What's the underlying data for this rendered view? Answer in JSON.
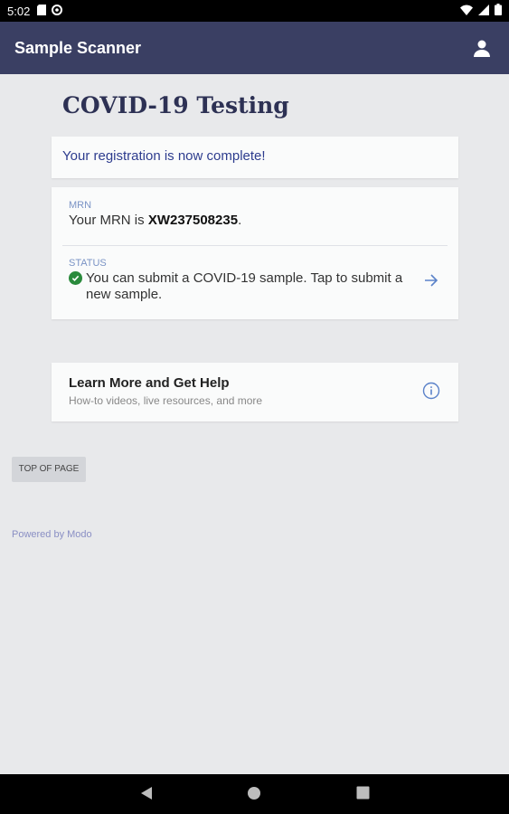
{
  "status_bar": {
    "time": "5:02"
  },
  "app_bar": {
    "title": "Sample Scanner"
  },
  "page": {
    "title": "COVID-19 Testing"
  },
  "notice": {
    "message": "Your registration is now complete!"
  },
  "mrn": {
    "label": "MRN",
    "prefix": "Your MRN is ",
    "value": "XW237508235",
    "suffix": "."
  },
  "status": {
    "label": "STATUS",
    "text": "You can submit a COVID-19 sample. Tap to submit a new sample."
  },
  "help": {
    "title": "Learn More and Get Help",
    "subtitle": "How-to videos, live resources, and more"
  },
  "top_button": {
    "label": "TOP OF PAGE"
  },
  "footer": {
    "powered": "Powered by Modo"
  },
  "colors": {
    "app_bar": "#3a3f63",
    "background": "#e8e9eb",
    "success": "#2a8a3c",
    "link": "#5b82c9"
  }
}
